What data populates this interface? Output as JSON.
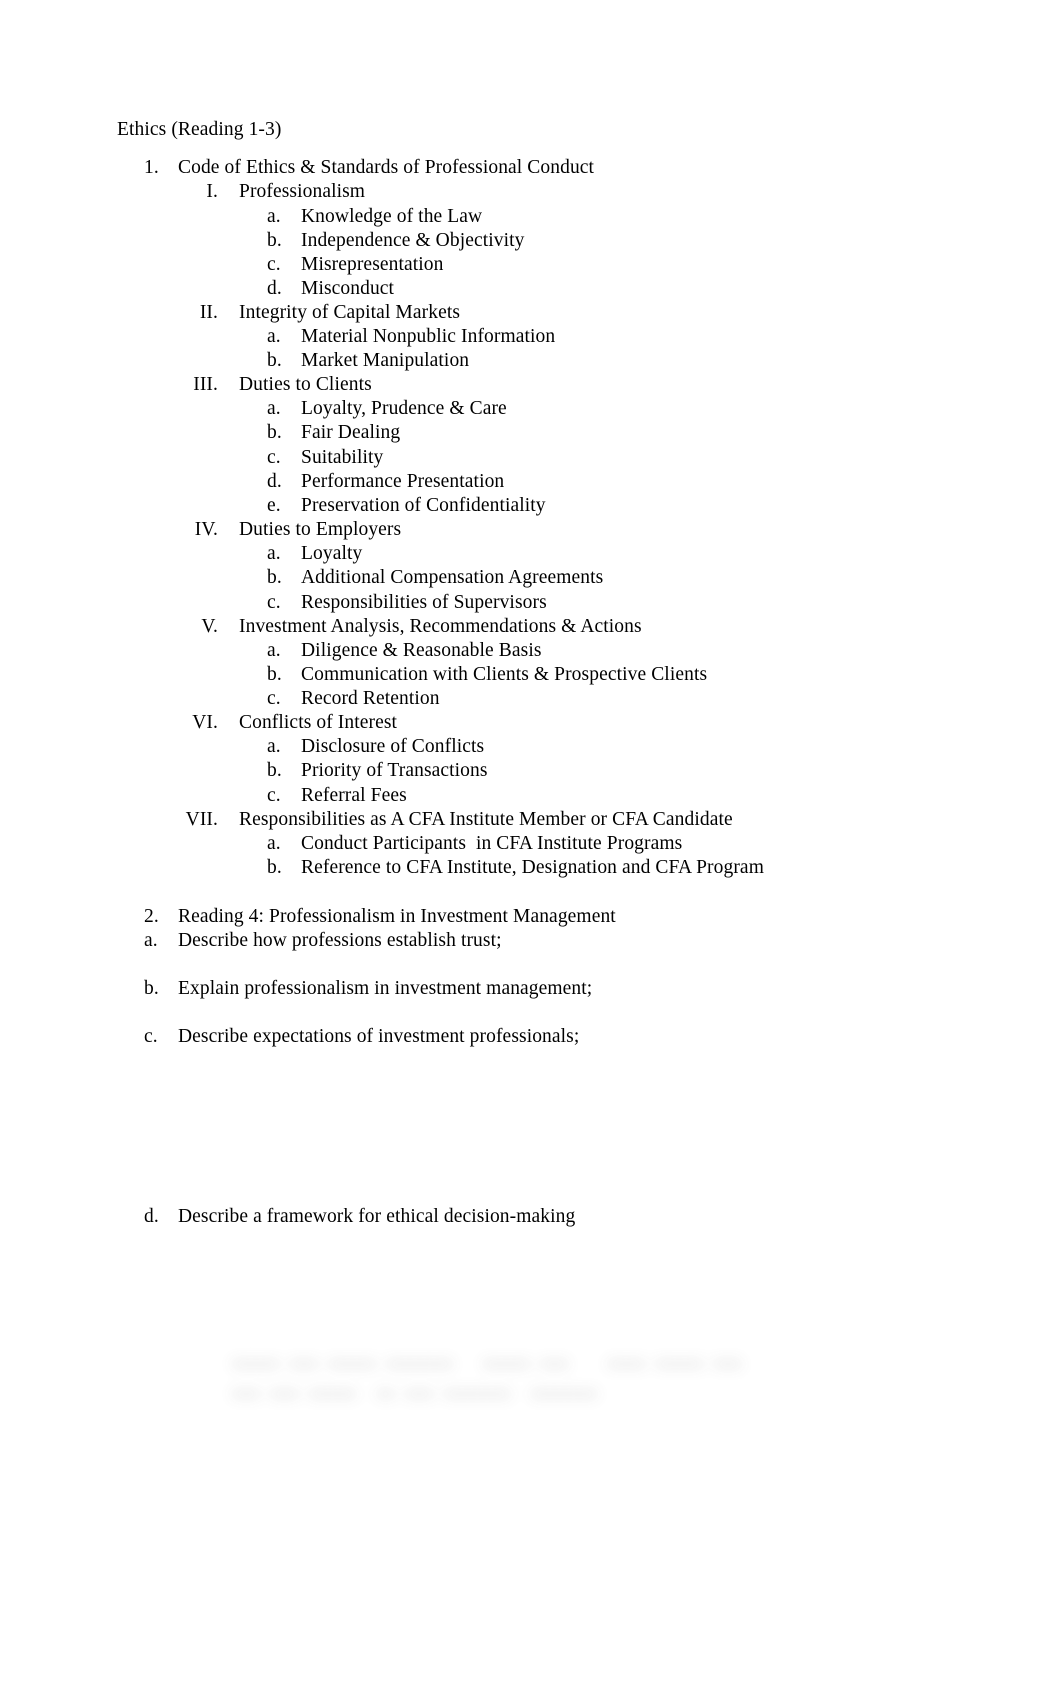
{
  "document": {
    "title": "Ethics (Reading 1-3)"
  },
  "outline": {
    "section1": {
      "marker": "1.",
      "label": "Code of Ethics & Standards of Professional Conduct",
      "roman_items": [
        {
          "marker": "I.",
          "label": "Professionalism",
          "sub": [
            {
              "marker": "a.",
              "label": "Knowledge of the Law"
            },
            {
              "marker": "b.",
              "label": "Independence & Objectivity"
            },
            {
              "marker": "c.",
              "label": "Misrepresentation"
            },
            {
              "marker": "d.",
              "label": "Misconduct"
            }
          ]
        },
        {
          "marker": "II.",
          "label": "Integrity of Capital Markets",
          "sub": [
            {
              "marker": "a.",
              "label": "Material Nonpublic Information"
            },
            {
              "marker": "b.",
              "label": "Market Manipulation"
            }
          ]
        },
        {
          "marker": "III.",
          "label": "Duties to Clients",
          "sub": [
            {
              "marker": "a.",
              "label": "Loyalty, Prudence & Care"
            },
            {
              "marker": "b.",
              "label": "Fair Dealing"
            },
            {
              "marker": "c.",
              "label": "Suitability"
            },
            {
              "marker": "d.",
              "label": "Performance Presentation"
            },
            {
              "marker": "e.",
              "label": "Preservation of Confidentiality"
            }
          ]
        },
        {
          "marker": "IV.",
          "label": "Duties to Employers",
          "sub": [
            {
              "marker": "a.",
              "label": "Loyalty"
            },
            {
              "marker": "b.",
              "label": "Additional Compensation Agreements"
            },
            {
              "marker": "c.",
              "label": "Responsibilities of Supervisors"
            }
          ]
        },
        {
          "marker": "V.",
          "label": "Investment Analysis, Recommendations & Actions",
          "sub": [
            {
              "marker": "a.",
              "label": "Diligence & Reasonable Basis"
            },
            {
              "marker": "b.",
              "label": "Communication with Clients & Prospective Clients"
            },
            {
              "marker": "c.",
              "label": "Record Retention"
            }
          ]
        },
        {
          "marker": "VI.",
          "label": "Conflicts of Interest",
          "sub": [
            {
              "marker": "a.",
              "label": "Disclosure of Conflicts"
            },
            {
              "marker": "b.",
              "label": "Priority of Transactions"
            },
            {
              "marker": "c.",
              "label": "Referral Fees"
            }
          ]
        },
        {
          "marker": "VII.",
          "label": "Responsibilities as A CFA Institute Member or CFA Candidate",
          "sub": [
            {
              "marker": "a.",
              "label": "Conduct Participants  in CFA Institute Programs"
            },
            {
              "marker": "b.",
              "label": "Reference to CFA Institute, Designation and CFA Program"
            }
          ]
        }
      ]
    },
    "section2": {
      "marker": "2.",
      "label": "Reading 4: Professionalism in Investment Management",
      "items": [
        {
          "marker": "a.",
          "label": "Describe how professions establish trust;"
        },
        {
          "marker": "b.",
          "label": "Explain professionalism in investment management;"
        },
        {
          "marker": "c.",
          "label": "Describe expectations of investment professionals;"
        },
        {
          "marker": "d.",
          "label": "Describe a framework for ethical decision-making"
        }
      ]
    }
  },
  "footer": {
    "redacted_text": "xxxxx xxx xxxxx xxxxxxx   xxxxx xxx    xxxx xxxxx xxx\nxxx xxx xxxxx  xx xxx xxxxxxx  xxxxxxx"
  }
}
